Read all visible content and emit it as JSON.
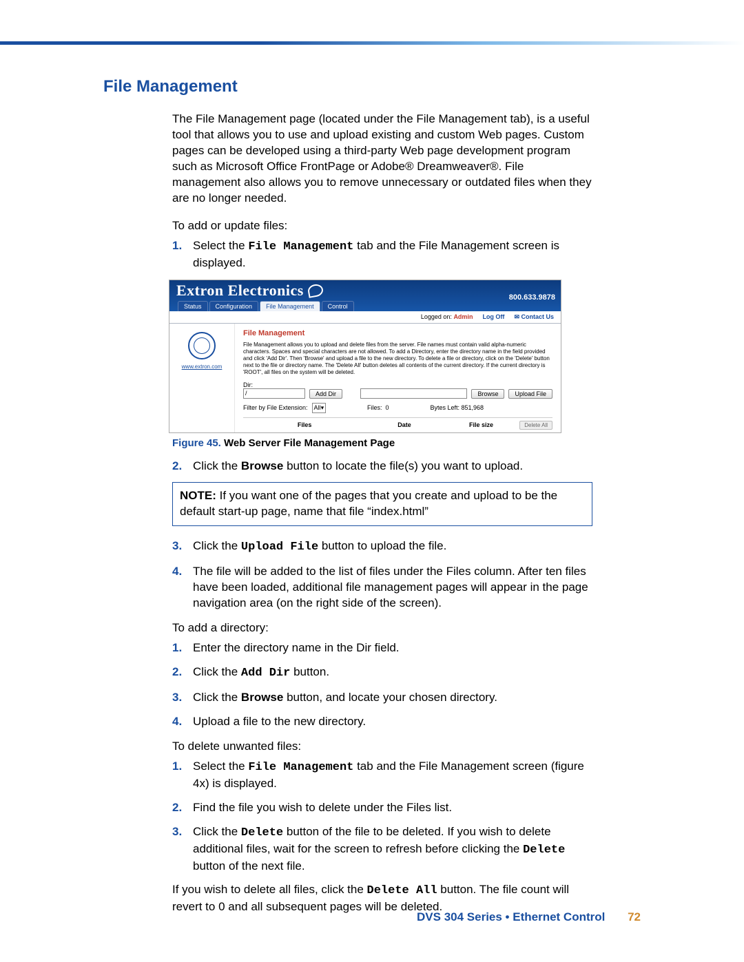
{
  "header": {
    "title": "File Management"
  },
  "intro": "The File Management page (located under the File Management tab), is a useful tool that allows you to use and upload existing and custom Web pages. Custom pages can be developed using a third-party Web page development program such as Microsoft Office FrontPage or Adobe® Dreamweaver®. File management also allows you to remove unnecessary or outdated files when they are no longer needed.",
  "sub_add_update": "To add or update files:",
  "steps_add_update": [
    {
      "n": "1.",
      "parts": [
        "Select the ",
        "File Management",
        " tab and the File Management screen is displayed."
      ]
    }
  ],
  "screenshot": {
    "brand": "Extron Electronics",
    "tabs": [
      "Status",
      "Configuration",
      "File Management",
      "Control"
    ],
    "active_tab": 2,
    "phone": "800.633.9878",
    "status": {
      "logged_on_label": "Logged on:",
      "user": "Admin",
      "logoff": "Log Off",
      "contact": "Contact Us"
    },
    "url": "www.extron.com",
    "fm_title": "File Management",
    "fm_desc": "File Management allows you to upload and delete files from the server. File names must contain valid alpha-numeric characters. Spaces and special characters are not allowed. To add a Directory, enter the directory name in the field provided and click 'Add Dir'. Then 'Browse' and upload a file to the new directory. To delete a file or directory, click on the 'Delete' button next to the file or directory name. The 'Delete All' button deletes all contents of the current directory. If the current directory is 'ROOT', all files on the system will be deleted.",
    "dir_label": "Dir:",
    "dir_value": "/",
    "add_dir": "Add Dir",
    "browse": "Browse",
    "upload": "Upload File",
    "filter_label": "Filter by File Extension:",
    "filter_value": "All",
    "files_label": "Files:",
    "files_count": "0",
    "bytes_label": "Bytes Left:",
    "bytes_value": "851,968",
    "cols": [
      "Files",
      "Date",
      "File size"
    ],
    "delete_all": "Delete All"
  },
  "figure": {
    "label": "Figure 45.",
    "title": "Web Server File Management Page"
  },
  "step2": {
    "n": "2.",
    "pre": "Click the ",
    "b": "Browse",
    "post": " button to locate the file(s) you want to upload."
  },
  "note": {
    "label": "NOTE:",
    "text": " If you want one of the pages that you create and upload to be the default start-up page, name that file “index.html”"
  },
  "step3": {
    "n": "3.",
    "pre": "Click the ",
    "m": "Upload File",
    "post": " button to upload the file."
  },
  "step4": {
    "n": "4.",
    "text": "The file will be added to the list of files under the Files column. After ten files have been loaded, additional file management pages will appear in the page navigation area (on the right side of the screen)."
  },
  "sub_add_dir": "To add a directory:",
  "dir_steps": [
    {
      "n": "1.",
      "text": "Enter the directory name in the Dir field."
    },
    {
      "n": "2.",
      "pre": "Click the ",
      "m": "Add Dir",
      "post": " button."
    },
    {
      "n": "3.",
      "pre": "Click the ",
      "b": "Browse",
      "post": " button, and locate your chosen directory."
    },
    {
      "n": "4.",
      "text": "Upload a file to the new directory."
    }
  ],
  "sub_delete": "To delete unwanted files:",
  "del_steps": [
    {
      "n": "1.",
      "pre": "Select the ",
      "m": "File Management",
      "post": " tab and the File Management screen (figure 4x) is displayed."
    },
    {
      "n": "2.",
      "text": "Find the file you wish to delete under the Files list."
    },
    {
      "n": "3.",
      "pre": "Click the ",
      "m1": "Delete",
      "mid": " button of the file to be deleted. If you wish to delete additional files, wait for the screen to refresh before clicking the ",
      "m2": "Delete",
      "post": " button of the next file."
    }
  ],
  "final_para": {
    "pre": "If you wish to delete all files, click the ",
    "m": "Delete All",
    "post": " button. The file count will revert to 0 and all subsequent pages will be deleted."
  },
  "footer": {
    "text": "DVS 304 Series • Ethernet Control",
    "page": "72"
  }
}
